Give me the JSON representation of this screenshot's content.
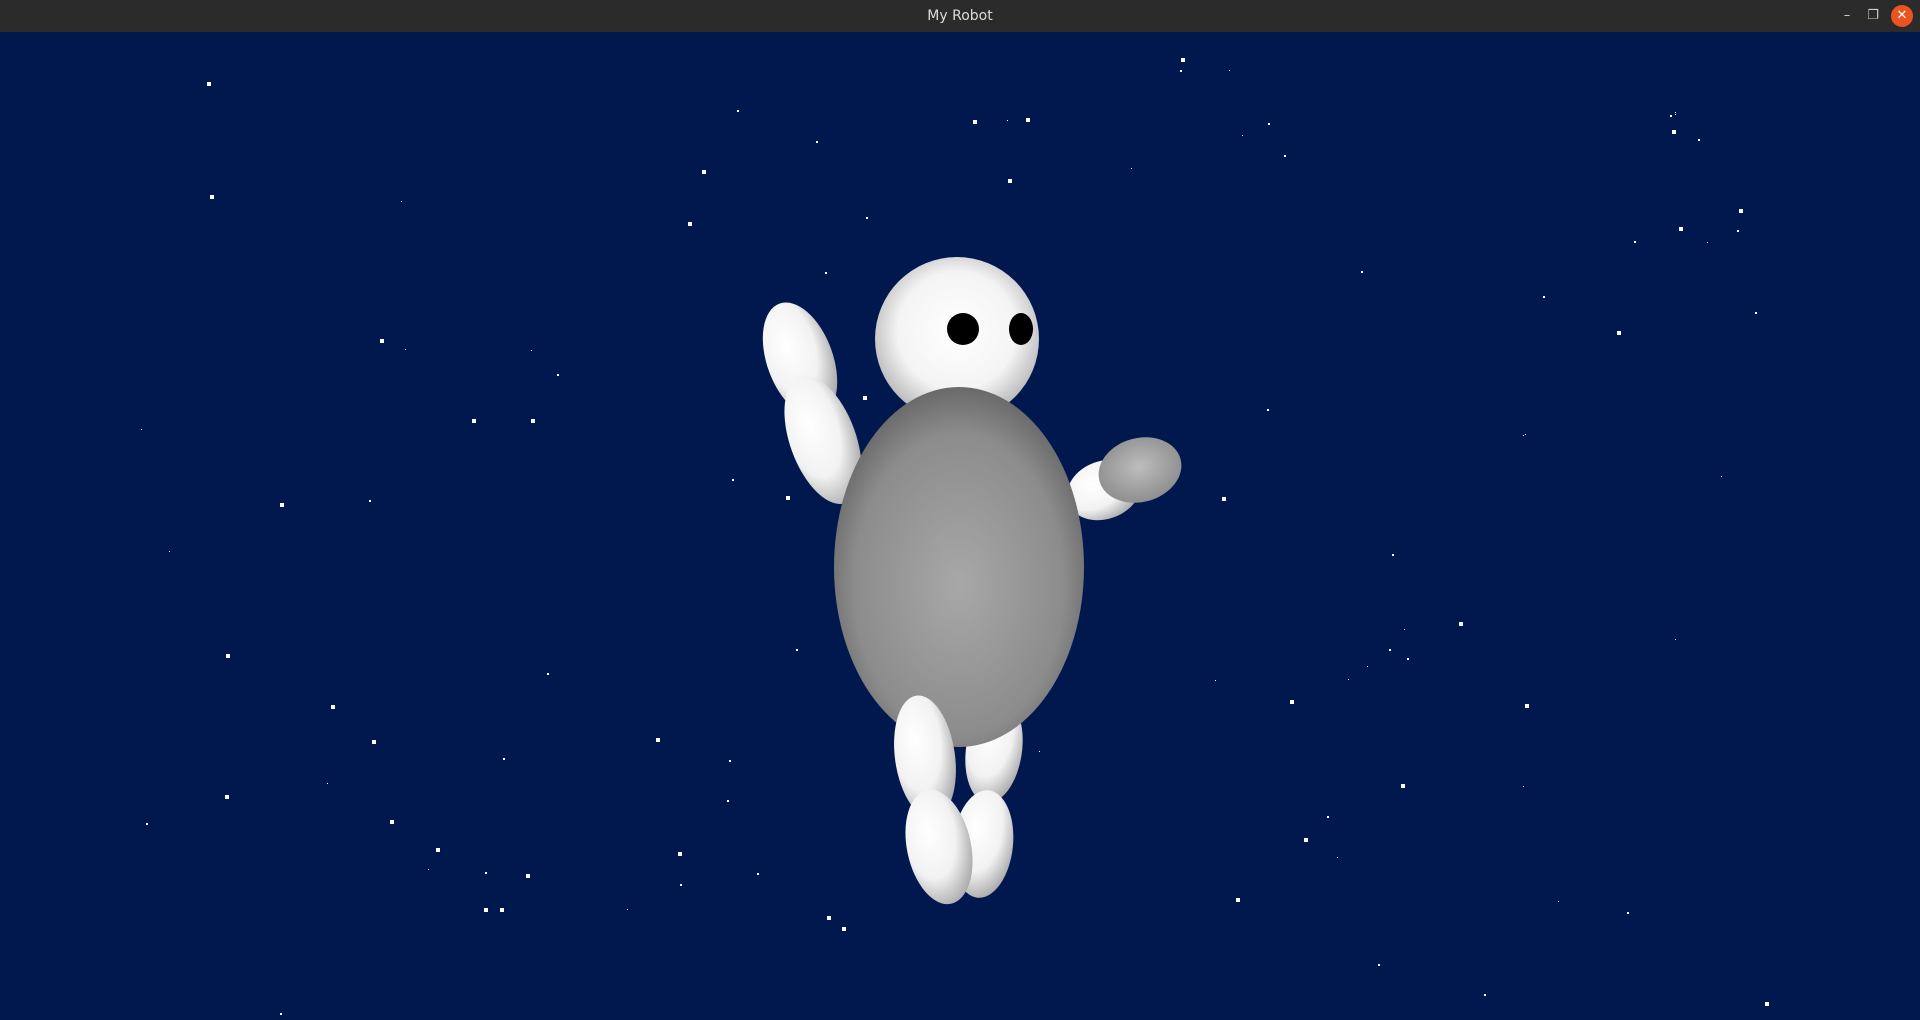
{
  "window": {
    "title": "My Robot"
  },
  "controls": {
    "minimize": "minimize-icon",
    "restore": "restore-icon",
    "close": "close-icon"
  },
  "scene": {
    "background": "#01184f",
    "star_color": "#ffffff",
    "body_color": "#8e8e8e",
    "limb_color": "#ffffff",
    "eye_color": "#000000"
  }
}
